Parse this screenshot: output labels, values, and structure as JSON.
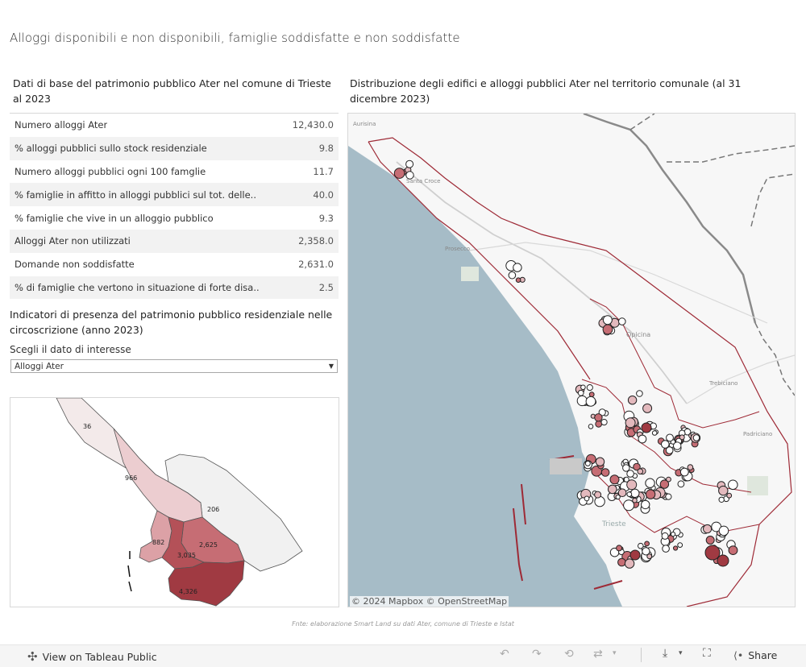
{
  "title": "Alloggi disponibili e non disponibili, famiglie soddisfatte e non soddisfatte",
  "kpi": {
    "header": "Dati di base del patrimonio pubblico Ater nel comune di Trieste al 2023",
    "rows": [
      {
        "label": "Numero alloggi Ater",
        "value": "12,430.0"
      },
      {
        "label": "% alloggi pubblici sullo stock residenziale",
        "value": "9.8"
      },
      {
        "label": "Numero alloggi pubblici ogni 100 famglie",
        "value": "11.7"
      },
      {
        "label": "% famiglie in affitto in alloggi pubblici sul tot. delle..",
        "value": "40.0"
      },
      {
        "label": "% famiglie che vive in un alloggio pubblico",
        "value": "9.3"
      },
      {
        "label": "Alloggi Ater non utilizzati",
        "value": "2,358.0"
      },
      {
        "label": "Domande non soddisfatte",
        "value": "2,631.0"
      },
      {
        "label": "% di famiglie che vertono in situazione di forte disa..",
        "value": "2.5"
      }
    ]
  },
  "indicators": {
    "header": "Indicatori di presenza del patrimonio pubblico residenziale nelle circoscrizione (anno 2023)",
    "filter_label": "Scegli il dato di interesse",
    "filter_value": "Alloggi Ater",
    "districts": [
      {
        "label": "36",
        "color": "#f3eaea"
      },
      {
        "label": "966",
        "color": "#eccdd0"
      },
      {
        "label": "206",
        "color": "#f1f1f1"
      },
      {
        "label": "882",
        "color": "#dca1a6"
      },
      {
        "label": "2,625",
        "color": "#c66d74"
      },
      {
        "label": "3,035",
        "color": "#b45158"
      },
      {
        "label": "4,326",
        "color": "#a03a42"
      }
    ]
  },
  "map": {
    "header": "Distribuzione degli edifici e alloggi pubblici Ater nel territorio comunale (al 31 dicembre 2023)",
    "places": [
      "Aurisina",
      "Santa Croce",
      "Prosecco",
      "Opicina",
      "Trebiciano",
      "Padriciano",
      "Trieste"
    ],
    "attribution": "© 2024 Mapbox  © OpenStreetMap",
    "sea_color": "#a6bcc7",
    "boundary_color": "#9e2a36"
  },
  "source": "Fnte: elaborazione Smart Land su dati Ater, comune di Trieste e Istat",
  "footer": {
    "view_label": "View on Tableau Public",
    "share_label": "Share"
  }
}
